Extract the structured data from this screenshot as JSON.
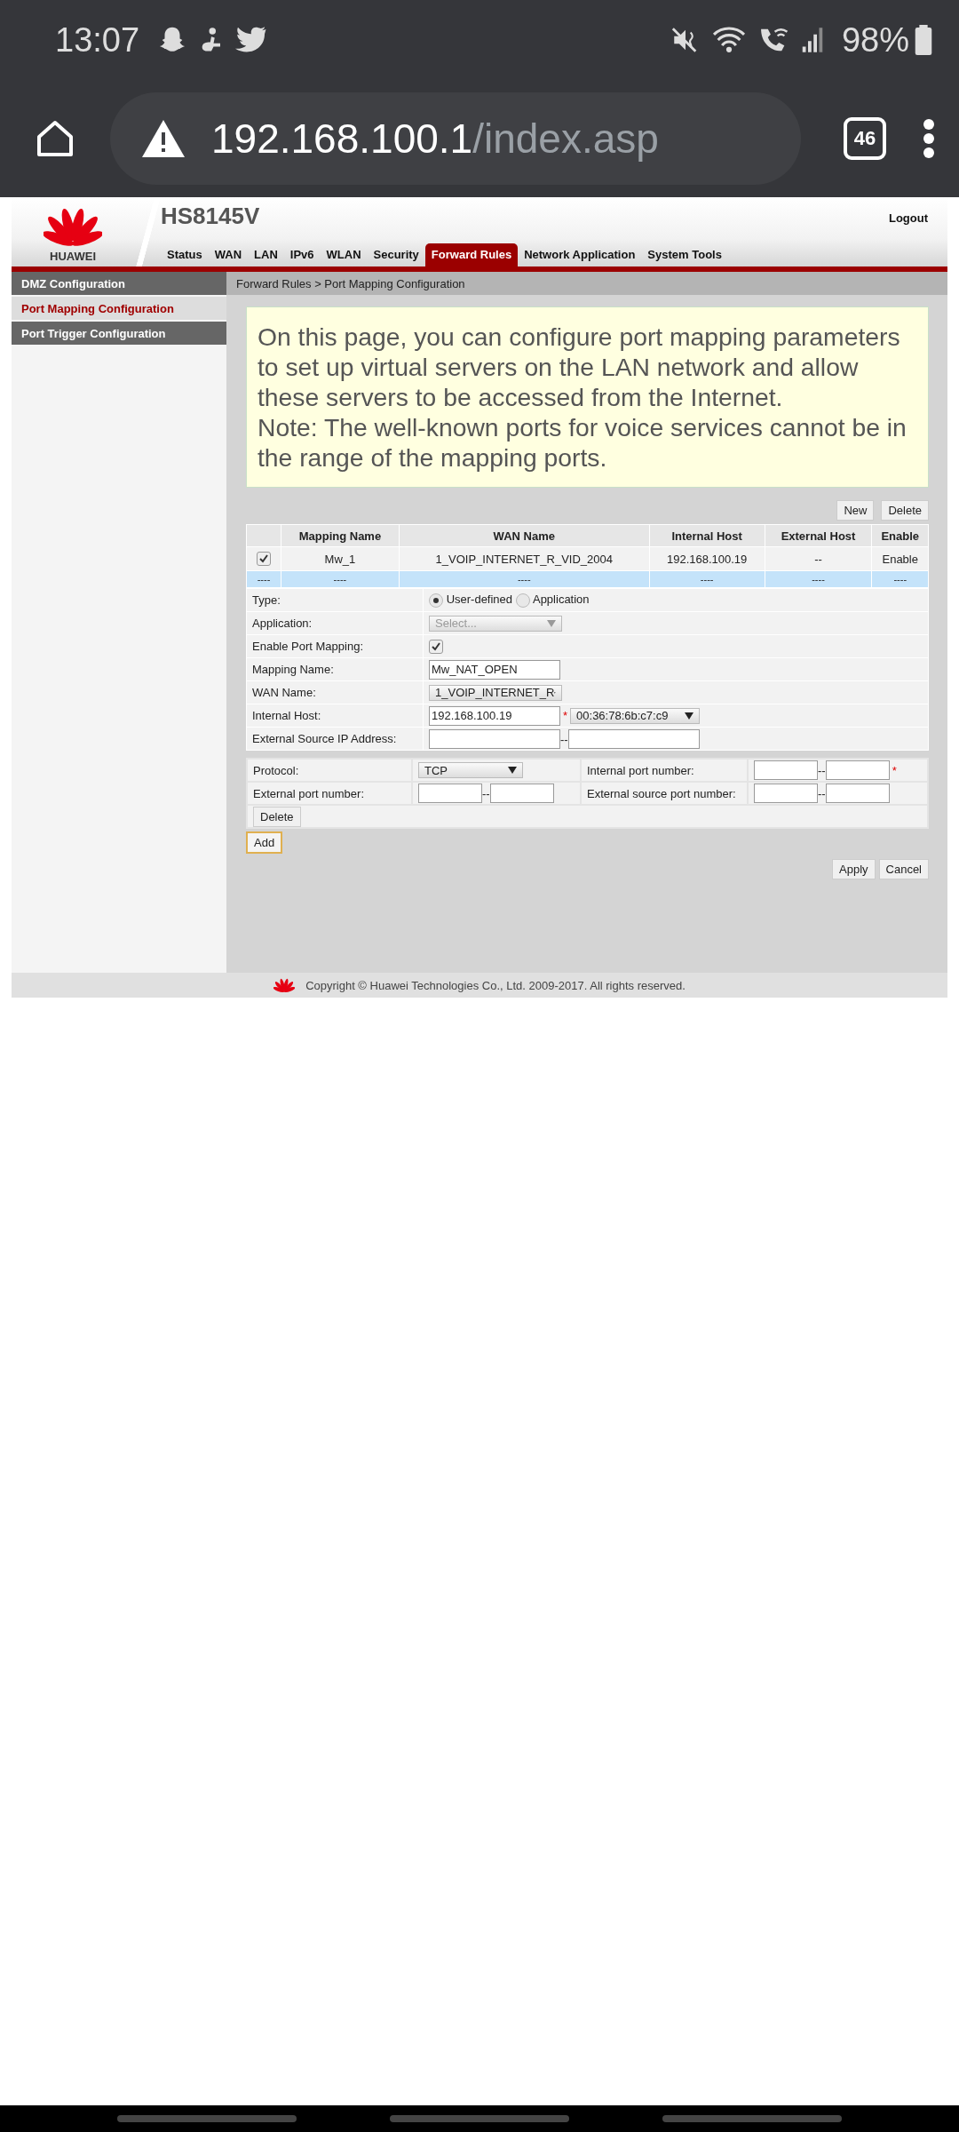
{
  "status_bar": {
    "time": "13:07",
    "battery": "98%"
  },
  "browser": {
    "url_host": "192.168.100.1",
    "url_path": "/index.asp",
    "tab_count": "46"
  },
  "header": {
    "logo_text": "HUAWEI",
    "model": "HS8145V",
    "logout": "Logout",
    "nav": [
      {
        "label": "Status",
        "selected": false
      },
      {
        "label": "WAN",
        "selected": false
      },
      {
        "label": "LAN",
        "selected": false
      },
      {
        "label": "IPv6",
        "selected": false
      },
      {
        "label": "WLAN",
        "selected": false
      },
      {
        "label": "Security",
        "selected": false
      },
      {
        "label": "Forward Rules",
        "selected": true
      },
      {
        "label": "Network Application",
        "selected": false
      },
      {
        "label": "System Tools",
        "selected": false
      }
    ]
  },
  "sidebar": {
    "items": [
      {
        "label": "DMZ Configuration",
        "selected": false
      },
      {
        "label": "Port Mapping Configuration",
        "selected": true
      },
      {
        "label": "Port Trigger Configuration",
        "selected": false
      }
    ]
  },
  "breadcrumb": "Forward Rules > Port Mapping Configuration",
  "notice": [
    "On this page, you can configure port mapping parameters to set up virtual servers on the LAN network and allow these servers to be accessed from the Internet.",
    "Note: The well-known ports for voice services cannot be in the range of the mapping ports."
  ],
  "table_buttons": [
    "New",
    "Delete"
  ],
  "table": {
    "columns": [
      "Mapping Name",
      "WAN Name",
      "Internal Host",
      "External Host",
      "Enable"
    ],
    "rows": [
      {
        "kind": "entry",
        "selected": false,
        "checked": true,
        "cells": [
          "Mw_1",
          "1_VOIP_INTERNET_R_VID_2004",
          "192.168.100.19",
          "--",
          "Enable"
        ]
      },
      {
        "kind": "blank",
        "selected": true,
        "marker": "----",
        "cells": [
          "----",
          "----",
          "----",
          "----",
          "----"
        ]
      }
    ]
  },
  "form": [
    {
      "kind": "radio",
      "label": "Type:",
      "options": [
        {
          "label": "User-defined",
          "selected": true
        },
        {
          "label": "Application",
          "selected": false
        }
      ]
    },
    {
      "kind": "select",
      "label": "Application:",
      "placeholder": "Select...",
      "disabled": true
    },
    {
      "kind": "checkbox",
      "label": "Enable Port Mapping:",
      "checked": true
    },
    {
      "kind": "text",
      "label": "Mapping Name:",
      "value": "Mw_NAT_OPEN"
    },
    {
      "kind": "select",
      "label": "WAN Name:",
      "value": "1_VOIP_INTERNET_R",
      "disabled": false
    },
    {
      "kind": "host",
      "label": "Internal Host:",
      "value": "192.168.100.19",
      "required_mark": "*",
      "select": "00:36:78:6b:c7:c9"
    },
    {
      "kind": "range",
      "label": "External Source IP Address:",
      "separator": "--"
    }
  ],
  "ports": {
    "protocol_label": "Protocol:",
    "protocol": "TCP",
    "internal_label": "Internal port number:",
    "internal_separator": "--",
    "internal_required_mark": "*",
    "external_label": "External port number:",
    "external_separator": "--",
    "source_label": "External source port number:",
    "source_separator": "--",
    "delete": "Delete"
  },
  "add": "Add",
  "actions": [
    "Apply",
    "Cancel"
  ],
  "footer": "Copyright © Huawei Technologies Co., Ltd. 2009-2017. All rights reserved."
}
